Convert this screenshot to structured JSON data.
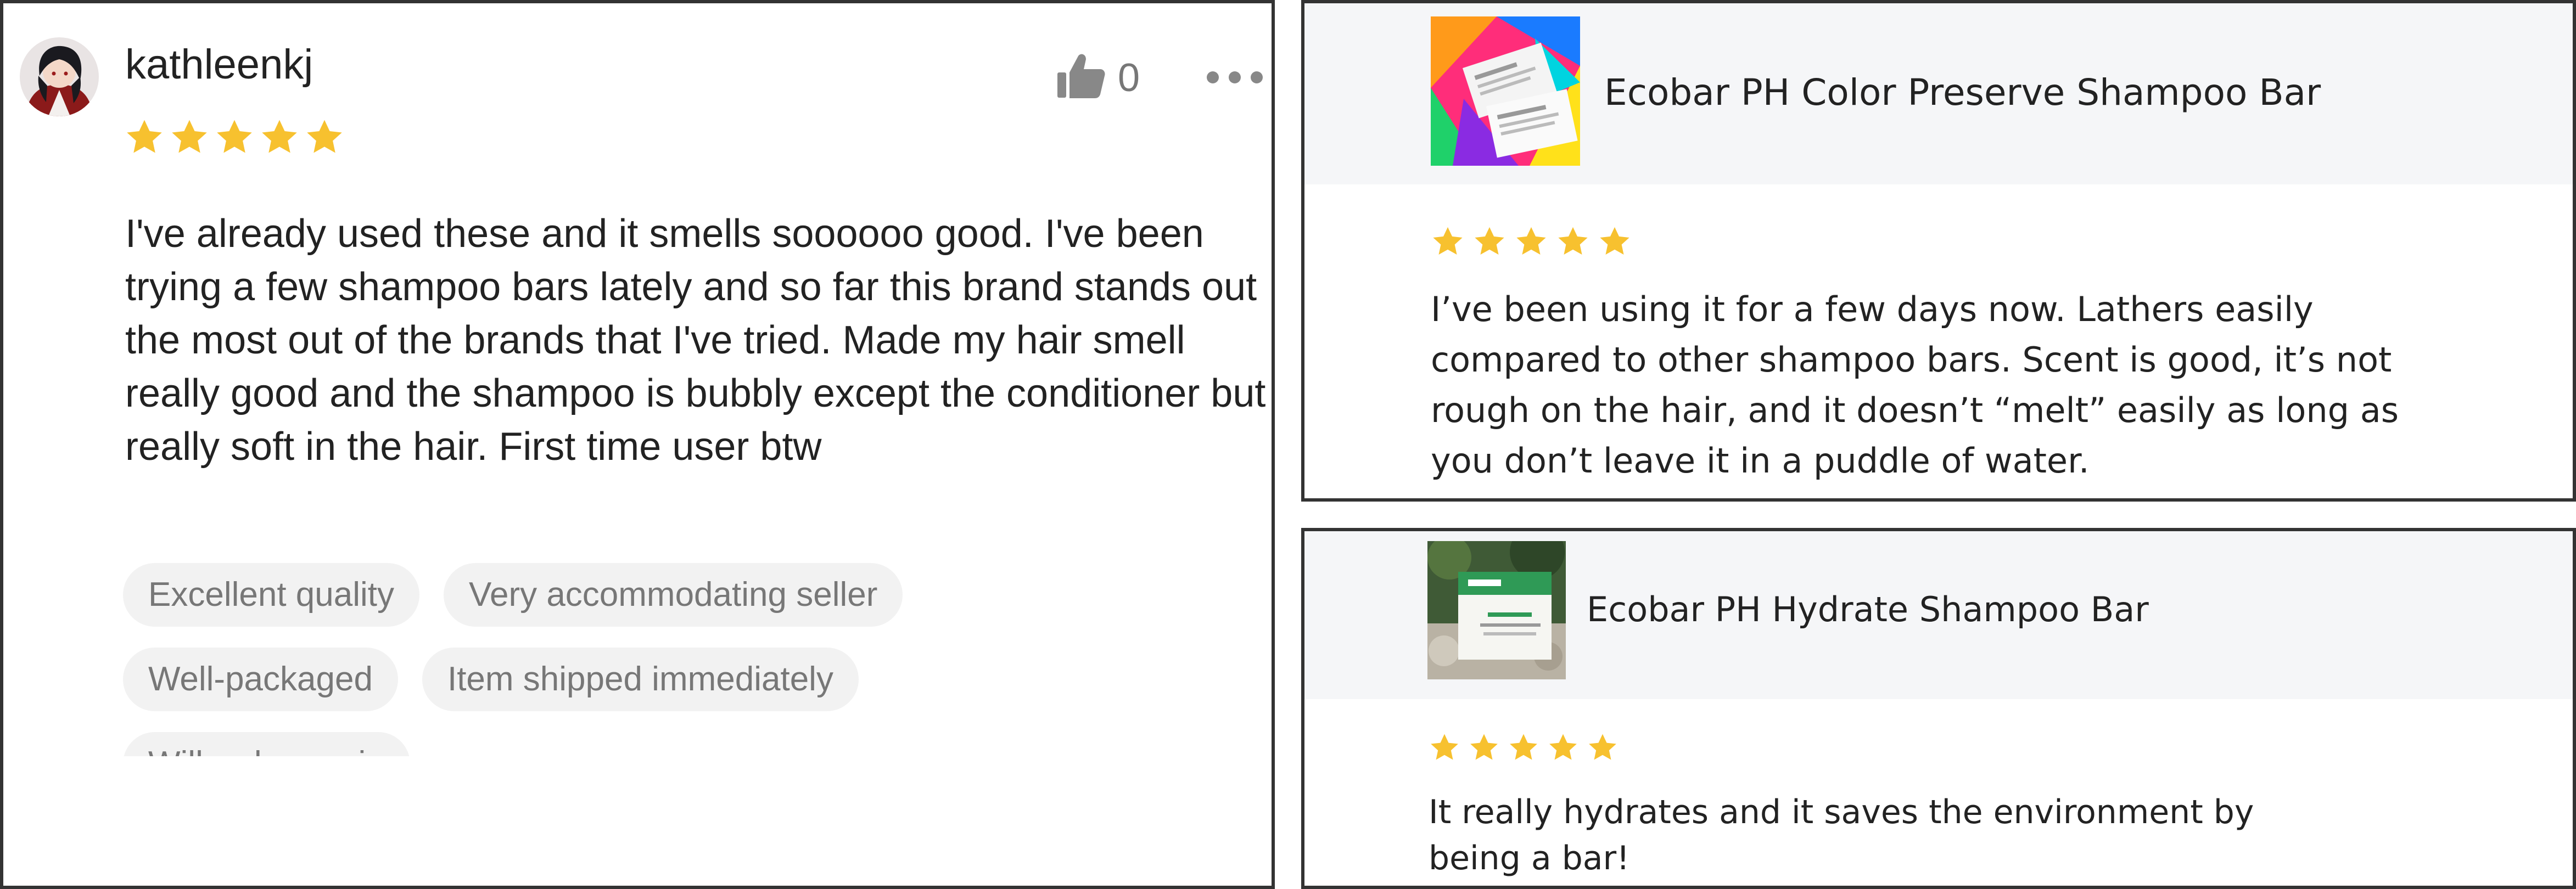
{
  "review": {
    "username": "kathleenkj",
    "rating": 5,
    "like_count": "0",
    "text": "I've already used these and it smells soooooo good. I've been trying a few shampoo bars lately and so far this brand stands out the most out of the brands that I've tried. Made my hair smell really good and the shampoo is bubbly except the conditioner but really soft in the hair. First time user btw",
    "tags": [
      "Excellent quality",
      "Very accommodating seller",
      "Well-packaged",
      "Item shipped immediately",
      "Will order again"
    ]
  },
  "product_reviews": [
    {
      "product_name": "Ecobar PH Color Preserve Shampoo Bar",
      "rating": 5,
      "text": "I’ve been using it for a few days now. Lathers easily compared to other shampoo bars. Scent is good, it’s not rough on the hair, and it doesn’t “melt” easily as long as you don’t leave it in a puddle of water."
    },
    {
      "product_name": "Ecobar PH Hydrate Shampoo Bar",
      "rating": 5,
      "text": "It really hydrates and it saves the environment by being a bar!"
    }
  ],
  "colors": {
    "star": "#F7C12F",
    "tag_background": "#F2F2F2",
    "tag_text": "#777777",
    "header_background": "#F5F6F8",
    "icon_gray": "#888888"
  },
  "icons": {
    "like": "thumbs-up-icon",
    "more": "more-options-icon",
    "star": "star-icon"
  }
}
